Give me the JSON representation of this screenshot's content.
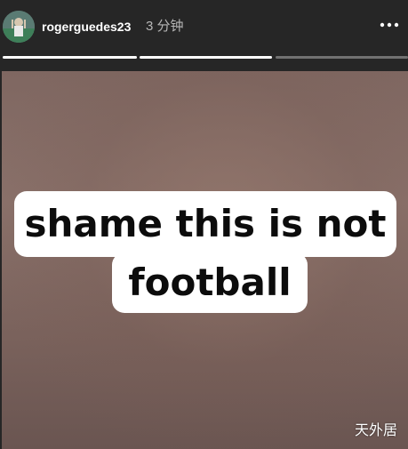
{
  "header": {
    "username": "rogerguedes23",
    "time": "3 分钟",
    "more_icon": "more-horizontal-icon"
  },
  "progress": {
    "segments": [
      {
        "fill": 1.0
      },
      {
        "fill": 1.0
      },
      {
        "fill": 0.0
      }
    ]
  },
  "story": {
    "caption_line1": "shame this is not",
    "caption_line2": "football"
  },
  "watermark": "天外居",
  "colors": {
    "background": "#262626",
    "caption_bg": "#ffffff",
    "caption_text": "#0c0c0c"
  }
}
